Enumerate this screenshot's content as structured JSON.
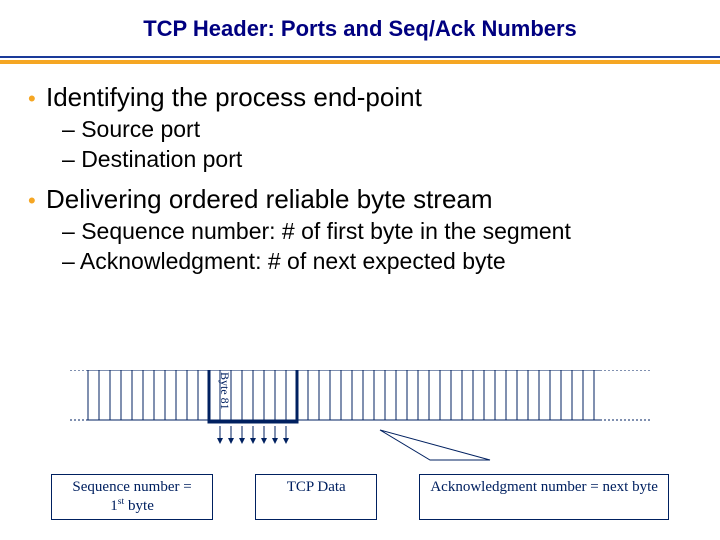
{
  "title": "TCP Header: Ports and Seq/Ack Numbers",
  "bullets": [
    {
      "text": "Identifying the process end-point",
      "sub": [
        "Source port",
        "Destination port"
      ]
    },
    {
      "text": "Delivering ordered reliable byte stream",
      "sub": [
        "Sequence number: # of first byte in the segment",
        "Acknowledgment: # of next expected byte"
      ]
    }
  ],
  "diagram": {
    "byte_label": "Byte 81",
    "captions": {
      "seq": "Sequence number =",
      "seq2": "1",
      "seq2_suffix": "st",
      "seq2_tail": " byte",
      "data": "TCP Data",
      "ack": "Acknowledgment number = next byte"
    }
  }
}
